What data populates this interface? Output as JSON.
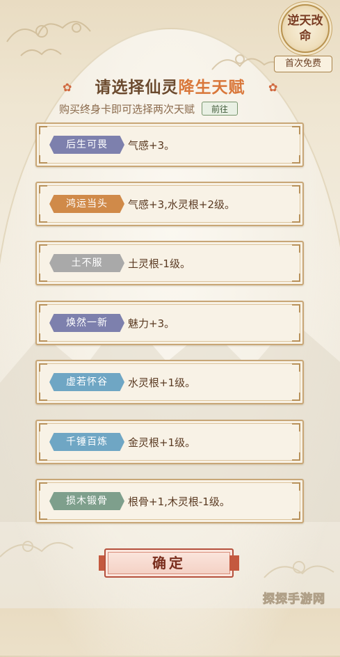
{
  "seal": {
    "text": "逆天改命"
  },
  "free_badge": "首次免费",
  "title": {
    "part1": "请选择仙灵",
    "highlight": "降生天赋"
  },
  "subtitle": "购买终身卡即可选择两次天赋",
  "go_button": "前往",
  "talents": [
    {
      "name": "后生可畏",
      "effect": "气感+3。",
      "tag_color": "#7d80ad"
    },
    {
      "name": "鸿运当头",
      "effect": "气感+3,水灵根+2级。",
      "tag_color": "#d08a49"
    },
    {
      "name": "土不服",
      "effect": "土灵根-1级。",
      "tag_color": "#a9a9a9"
    },
    {
      "name": "焕然一新",
      "effect": "魅力+3。",
      "tag_color": "#7d80ad"
    },
    {
      "name": "虚若怀谷",
      "effect": "水灵根+1级。",
      "tag_color": "#6fa6c4"
    },
    {
      "name": "千锤百炼",
      "effect": "金灵根+1级。",
      "tag_color": "#6fa6c4"
    },
    {
      "name": "损木锻骨",
      "effect": "根骨+1,木灵根-1级。",
      "tag_color": "#7e9f8c"
    }
  ],
  "confirm_button": "确定",
  "watermark": "探探手游网"
}
